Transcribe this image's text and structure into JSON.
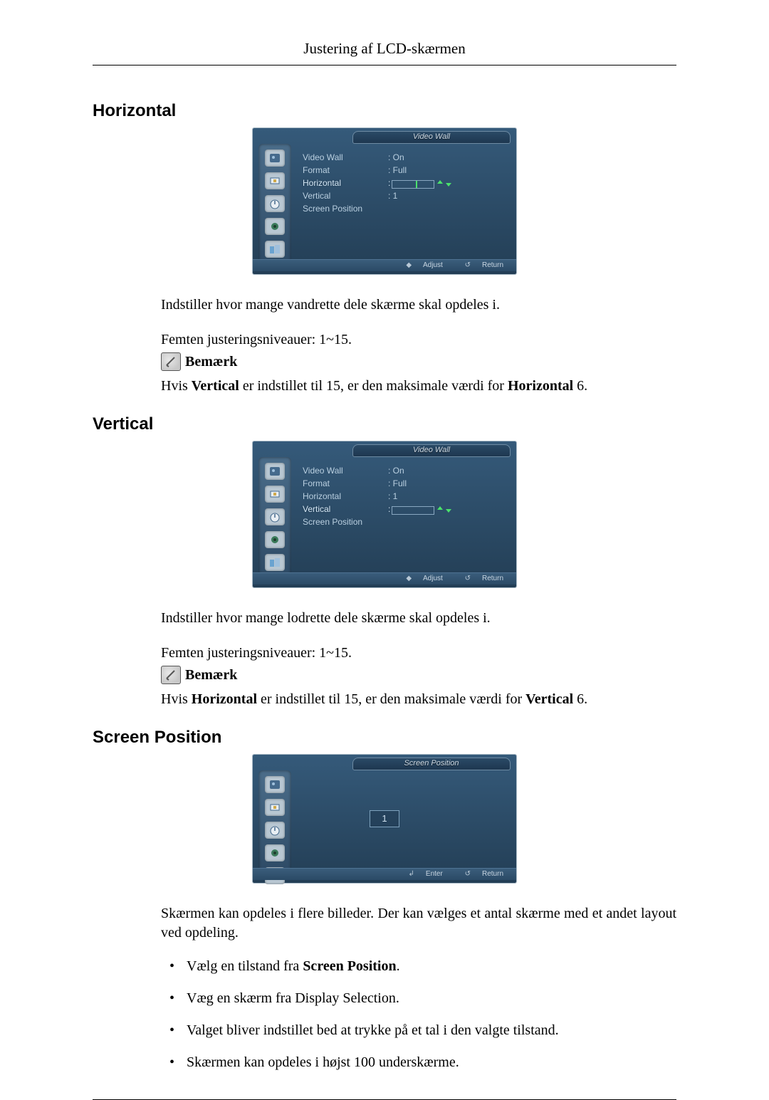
{
  "header": {
    "title": "Justering af LCD-skærmen"
  },
  "sections": {
    "horizontal": {
      "heading": "Horizontal",
      "desc1": "Indstiller hvor mange vandrette dele skærme skal opdeles i.",
      "desc2": "Femten justeringsniveauer: 1~15.",
      "note_label": "Bemærk",
      "note_text_pre": "Hvis ",
      "note_text_bold1": "Vertical",
      "note_text_mid": " er indstillet til 15, er den maksimale værdi for ",
      "note_text_bold2": "Horizontal",
      "note_text_post": " 6."
    },
    "vertical": {
      "heading": "Vertical",
      "desc1": "Indstiller hvor mange lodrette dele skærme skal opdeles i.",
      "desc2": "Femten justeringsniveauer: 1~15.",
      "note_label": "Bemærk",
      "note_text_pre": "Hvis ",
      "note_text_bold1": "Horizontal",
      "note_text_mid": " er indstillet til 15, er den maksimale værdi for ",
      "note_text_bold2": "Vertical",
      "note_text_post": " 6."
    },
    "screen_position": {
      "heading": "Screen Position",
      "desc": "Skærmen kan opdeles i flere billeder. Der kan vælges et antal skærme med et andet layout ved opdeling.",
      "bullets": {
        "b1_pre": "Vælg en tilstand fra ",
        "b1_bold": "Screen Position",
        "b1_post": ".",
        "b2": "Væg en skærm fra Display Selection.",
        "b3": "Valget bliver indstillet bed at trykke på et tal i den valgte tilstand.",
        "b4": "Skærmen kan opdeles i højst 100 underskærme."
      }
    }
  },
  "menu_horizontal": {
    "title": "Video Wall",
    "items": [
      {
        "label": "Video Wall",
        "value": ": On"
      },
      {
        "label": "Format",
        "value": ": Full"
      },
      {
        "label": "Horizontal",
        "value": ":"
      },
      {
        "label": "Vertical",
        "value": ": 1"
      },
      {
        "label": "Screen Position",
        "value": ""
      }
    ],
    "footer_left": "Adjust",
    "footer_right": "Return"
  },
  "menu_vertical": {
    "title": "Video Wall",
    "items": [
      {
        "label": "Video Wall",
        "value": ": On"
      },
      {
        "label": "Format",
        "value": ": Full"
      },
      {
        "label": "Horizontal",
        "value": ": 1"
      },
      {
        "label": "Vertical",
        "value": ":"
      },
      {
        "label": "Screen Position",
        "value": ""
      }
    ],
    "footer_left": "Adjust",
    "footer_right": "Return"
  },
  "menu_screen_position": {
    "title": "Screen Position",
    "value": "1",
    "footer_left": "Enter",
    "footer_right": "Return"
  }
}
